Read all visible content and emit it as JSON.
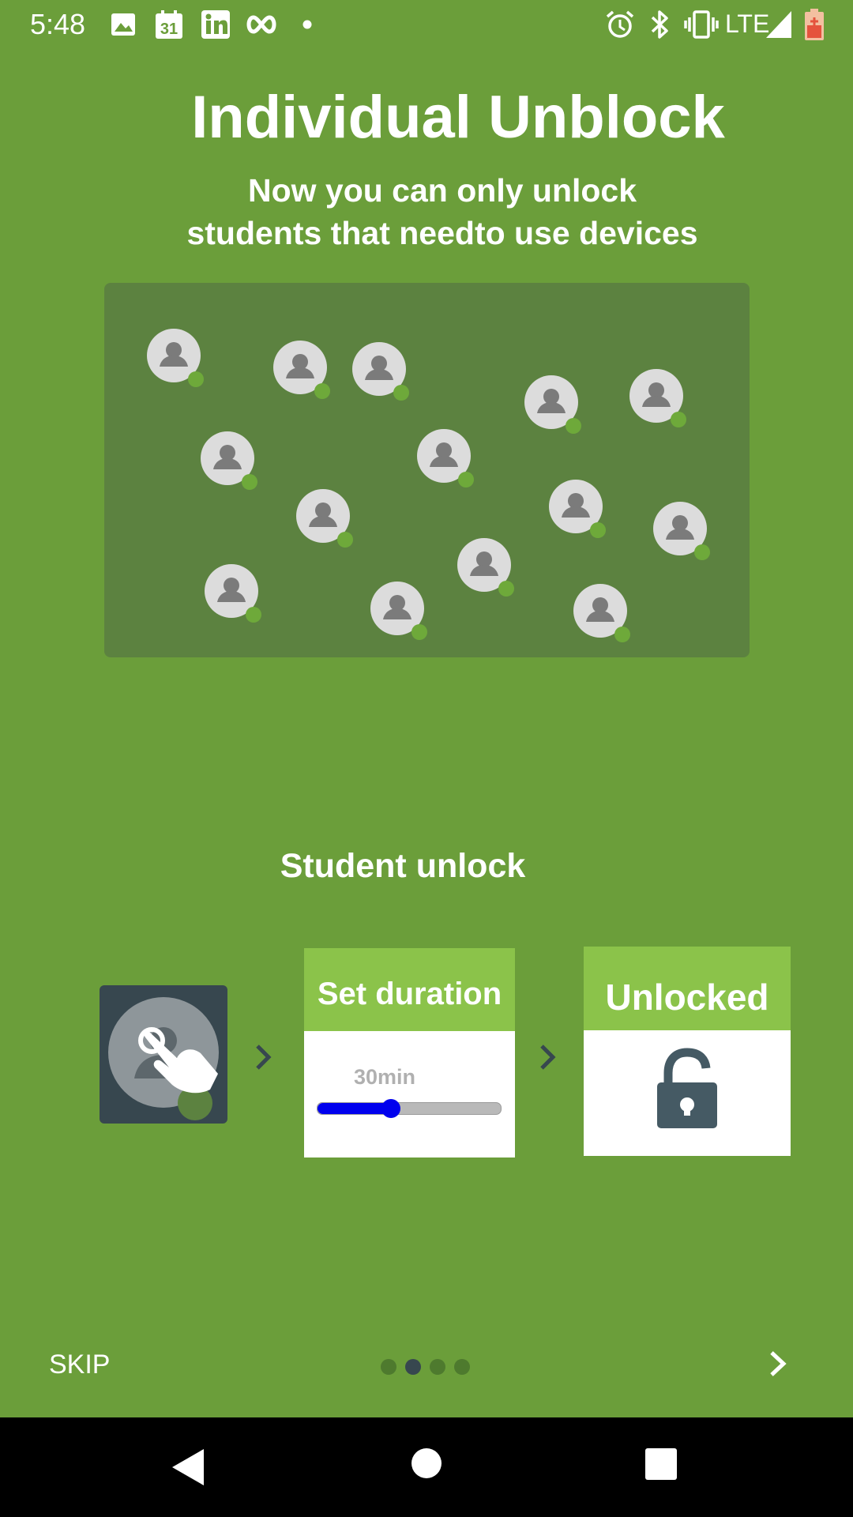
{
  "status_bar": {
    "time": "5:48",
    "network": "LTE",
    "icons": [
      "image-icon",
      "calendar-icon",
      "linkedin-icon",
      "infinity-icon",
      "dot-icon",
      "alarm-icon",
      "bluetooth-icon",
      "vibrate-icon",
      "signal-icon",
      "battery-icon"
    ],
    "calendar_day": "31"
  },
  "onboarding": {
    "title": "Individual Unblock",
    "subtitle_line1": "Now you can only unlock",
    "subtitle_line2": "students that needto use devices",
    "section_title": "Student unlock",
    "steps": {
      "tap_icon": "tap-student-icon",
      "duration_header": "Set duration",
      "duration_value": "30min",
      "duration_fraction": 0.4,
      "unlocked_header": "Unlocked",
      "unlocked_icon": "unlock-icon"
    },
    "skip_label": "SKIP",
    "page_indicator": {
      "total": 4,
      "active_index": 1
    },
    "next_icon": "chevron-right-icon"
  },
  "colors": {
    "background": "#6b9e3a",
    "panel": "#5c8240",
    "header_green": "#8bc34a",
    "slider_blue": "#0000ee",
    "dark_slate": "#37474f"
  },
  "system_nav": {
    "back": "back-icon",
    "home": "home-icon",
    "recents": "recents-icon"
  }
}
